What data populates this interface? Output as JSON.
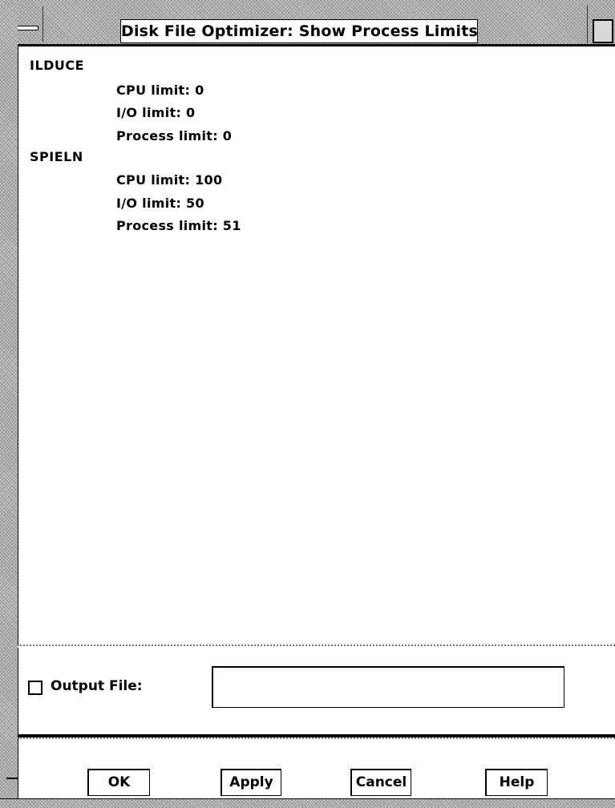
{
  "window": {
    "title": "Disk File Optimizer: Show Process Limits"
  },
  "processes": [
    {
      "name": "ILDUCE",
      "cpu_limit": "CPU limit: 0",
      "io_limit": "I/O limit: 0",
      "process_limit": "Process limit: 0"
    },
    {
      "name": "SPIELN",
      "cpu_limit": "CPU limit: 100",
      "io_limit": "I/O limit: 50",
      "process_limit": "Process limit: 51"
    }
  ],
  "output": {
    "checkbox_checked": false,
    "label": "Output File:",
    "value": ""
  },
  "buttons": {
    "ok": "OK",
    "apply": "Apply",
    "cancel": "Cancel",
    "help": "Help"
  },
  "icons": {
    "window_menu": "window-menu-icon",
    "resize": "resize-icon",
    "checkbox": "checkbox-icon"
  }
}
